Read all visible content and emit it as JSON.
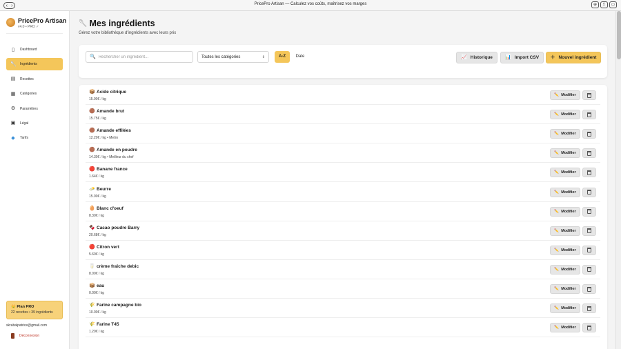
{
  "window": {
    "title": "PricePro Artisan — Calculez vos coûts, maîtrisez vos marges"
  },
  "sidebar": {
    "brand_name": "PricePro Artisan",
    "brand_version": "v4.0 • PRO ✓",
    "items": [
      {
        "label": "Dashboard",
        "icon": "▯"
      },
      {
        "label": "Ingrédients",
        "icon": "🥄"
      },
      {
        "label": "Recettes",
        "icon": "▤"
      },
      {
        "label": "Catégories",
        "icon": "▦"
      },
      {
        "label": "Paramètres",
        "icon": "⚙"
      },
      {
        "label": "Légal",
        "icon": "▣"
      },
      {
        "label": "Tarifs",
        "icon": "◆"
      }
    ],
    "plan_title": "👑 Plan PRO",
    "plan_sub": "22 recettes • 39 ingrédients",
    "user_email": "skrabalpatrice@gmail.com",
    "logout_label": "Déconnexion"
  },
  "header": {
    "title": "Mes ingrédients",
    "title_icon": "🥄",
    "subtitle": "Gérez votre bibliothèque d'ingrédients avec leurs prix"
  },
  "toolbar": {
    "search_placeholder": "Rechercher un ingrédient...",
    "category_selected": "Toutes les catégories",
    "sort_az": "A-Z",
    "sort_date": "Date",
    "history_label": "Historique",
    "import_label": "Import CSV",
    "new_label": "Nouvel ingrédient"
  },
  "list": {
    "edit_label": "Modifier",
    "items": [
      {
        "name": "Acide citrique",
        "icon": "📦",
        "meta": "15.90€ / kg"
      },
      {
        "name": "Amande brut",
        "icon": "🟤",
        "meta": "15.75€ / kg"
      },
      {
        "name": "Amande effilées",
        "icon": "🟤",
        "meta": "12.20€ / kg • Metro"
      },
      {
        "name": "Amande en poudre",
        "icon": "🟤",
        "meta": "14.30€ / kg • Meilleur du chef"
      },
      {
        "name": "Banane france",
        "icon": "🔴",
        "meta": "1.64€ / kg"
      },
      {
        "name": "Beurre",
        "icon": "🧈",
        "meta": "15.00€ / kg"
      },
      {
        "name": "Blanc d'oeuf",
        "icon": "🥚",
        "meta": "8.30€ / kg"
      },
      {
        "name": "Cacao poudre Barry",
        "icon": "🍫",
        "meta": "20.68€ / kg"
      },
      {
        "name": "Citron vert",
        "icon": "🔴",
        "meta": "5.60€ / kg"
      },
      {
        "name": "crème fraîche debic",
        "icon": "🥛",
        "meta": "8.00€ / kg"
      },
      {
        "name": "eau",
        "icon": "📦",
        "meta": "0.00€ / kg"
      },
      {
        "name": "Farine campagne bio",
        "icon": "🌾",
        "meta": "10.00€ / kg"
      },
      {
        "name": "Farine T45",
        "icon": "🌾",
        "meta": "1.20€ / kg"
      }
    ]
  }
}
